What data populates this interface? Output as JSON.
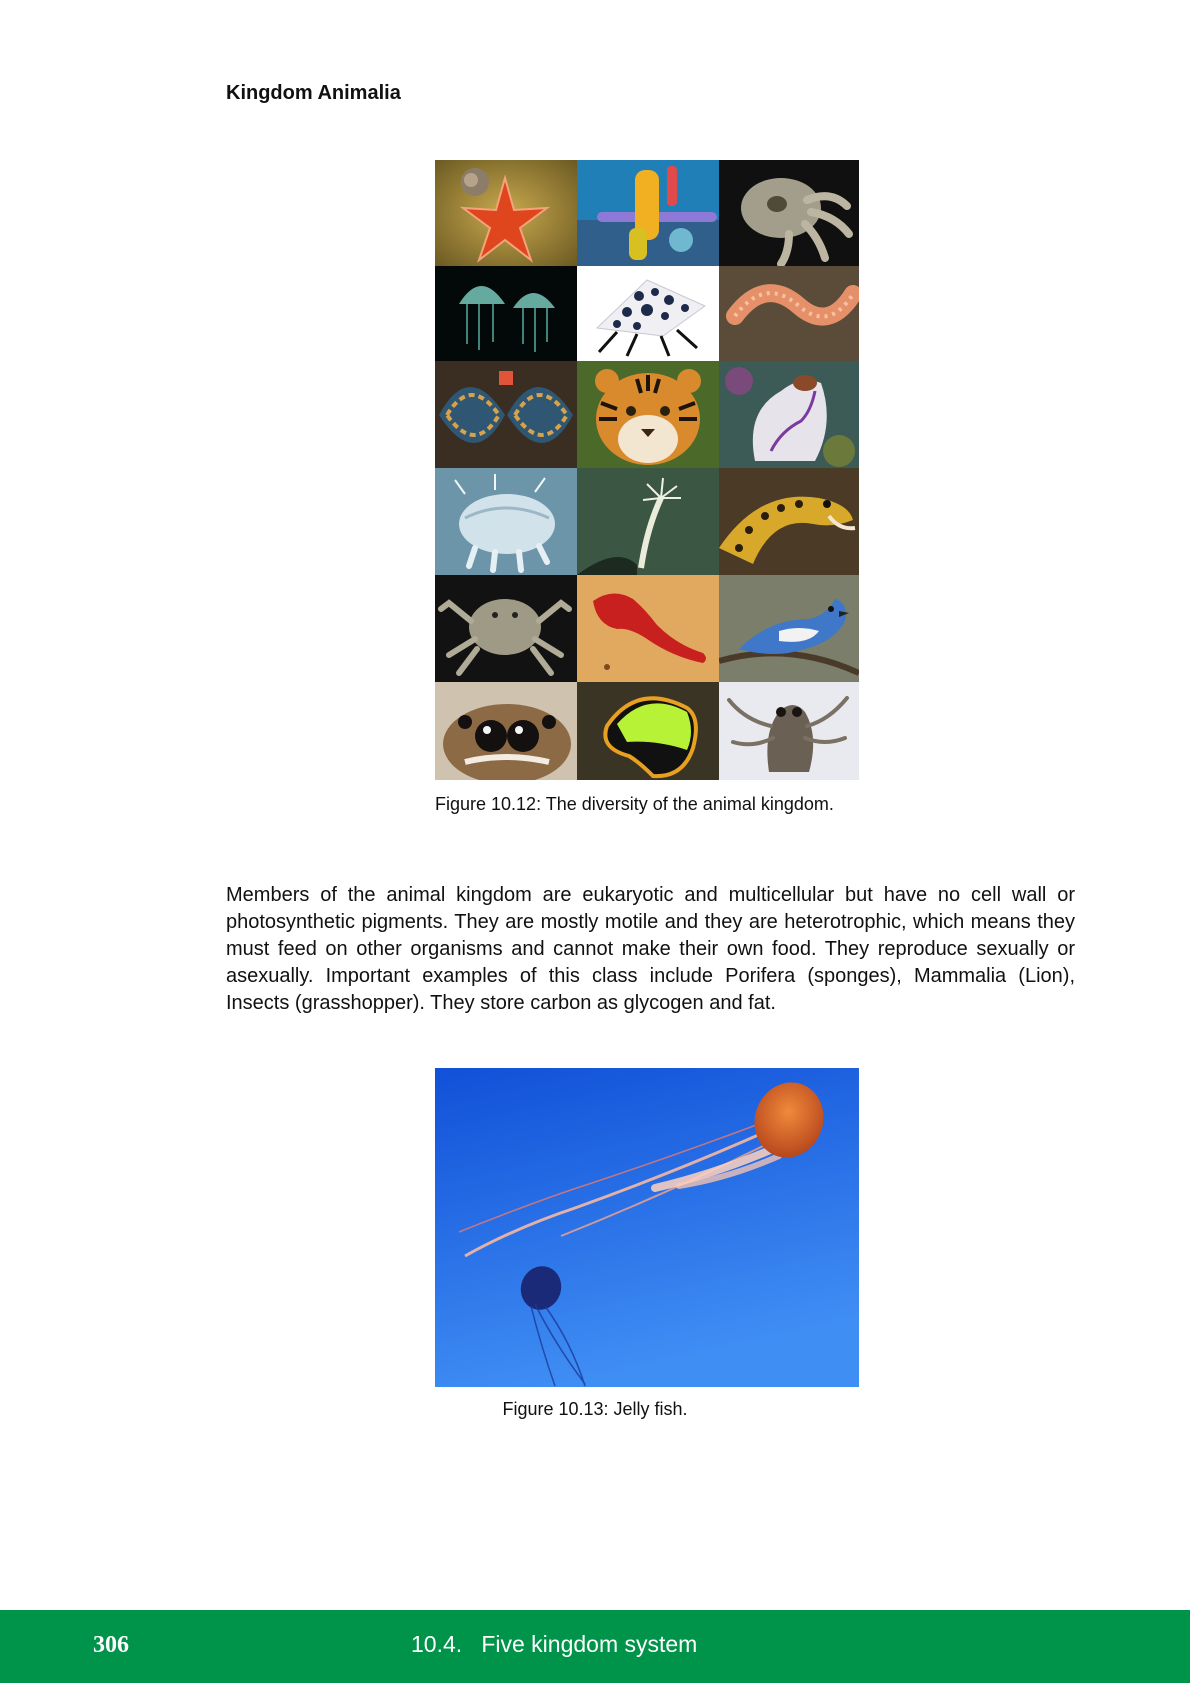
{
  "heading": "Kingdom Animalia",
  "figures": {
    "diversity": {
      "caption": "Figure 10.12: The diversity of the animal kingdom.",
      "tiles": [
        "starfish",
        "tube-sponge",
        "cuttlefish",
        "jellyfish-pair",
        "spotted-moth",
        "bristle-worm",
        "giant-clam",
        "tiger",
        "sea-squirt",
        "tardigrade",
        "hydroid",
        "moray-eel",
        "crab",
        "red-flatworm",
        "blue-jay",
        "jumping-spider",
        "flatworm-green",
        "ghost-cephalopod"
      ]
    },
    "jellyfish": {
      "caption": "Figure 10.13: Jelly fish."
    }
  },
  "paragraph": "Members of the animal kingdom are eukaryotic and multicellular but have no cell wall or photosynthetic pigments. They are mostly motile and they are heterotrophic, which means they must feed on other organisms and cannot make their own food. They reproduce sexually or asexually. Important examples of this class include Porifera (sponges), Mammalia (Lion), Insects (grasshopper). They store carbon as glycogen and fat.",
  "footer": {
    "page_number": "306",
    "section": "10.4.   Five kingdom system"
  },
  "colors": {
    "footer_band": "#00934a",
    "text": "#111111",
    "footer_text": "#ffffff"
  }
}
